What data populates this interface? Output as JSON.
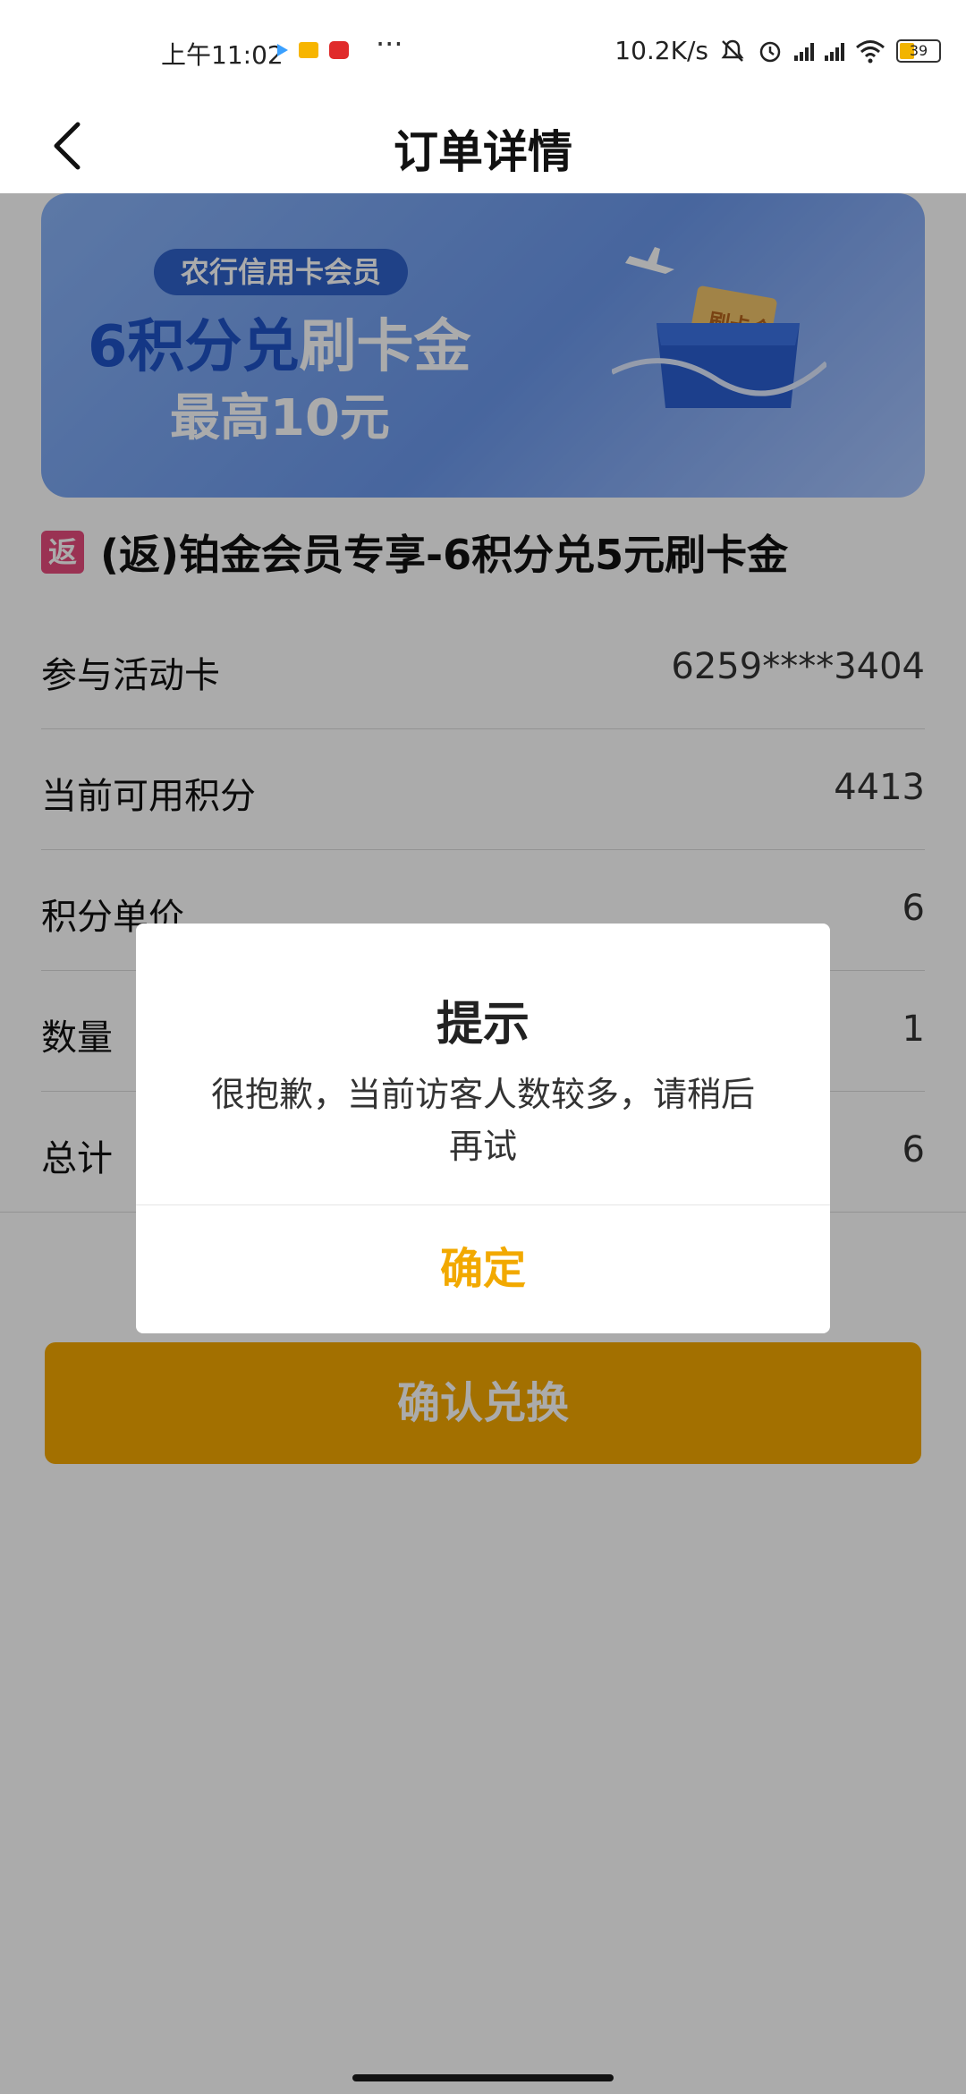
{
  "status_bar": {
    "time": "上午11:02",
    "more": "···",
    "network_speed": "10.2K/s",
    "battery": "39",
    "icons": [
      "play-store-icon",
      "message-icon",
      "app-notification-icon",
      "mute-icon",
      "alarm-icon",
      "hd-signal-icon",
      "hd-signal-icon-2",
      "wifi-icon",
      "battery-icon"
    ]
  },
  "nav": {
    "title": "订单详情",
    "back_icon": "chevron-left-icon"
  },
  "banner": {
    "pill": "农行信用卡会员",
    "line1_strong": "6积分兑",
    "line1_light": "刷卡金",
    "line2": "最高10元",
    "art_text": "刷卡金",
    "colors": {
      "background": "#7aa6f3",
      "pill": "#2f62c9",
      "accent": "#1e52c7"
    }
  },
  "product": {
    "tag": "返",
    "title": "(返)铂金会员专享-6积分兑5元刷卡金"
  },
  "details": [
    {
      "label": "参与活动卡",
      "value": "6259****3404"
    },
    {
      "label": "当前可用积分",
      "value": "4413"
    },
    {
      "label": "积分单价",
      "value": "6"
    },
    {
      "label": "数量",
      "value": "1"
    },
    {
      "label": "总计",
      "value": "6"
    }
  ],
  "confirm_button": "确认兑换",
  "dialog": {
    "title": "提示",
    "message": "很抱歉，当前访客人数较多，请稍后再试",
    "ok": "确定"
  },
  "colors": {
    "primary": "#f3a800",
    "overlay": "rgba(0,0,0,0.33)",
    "tag": "#e64b7d"
  }
}
